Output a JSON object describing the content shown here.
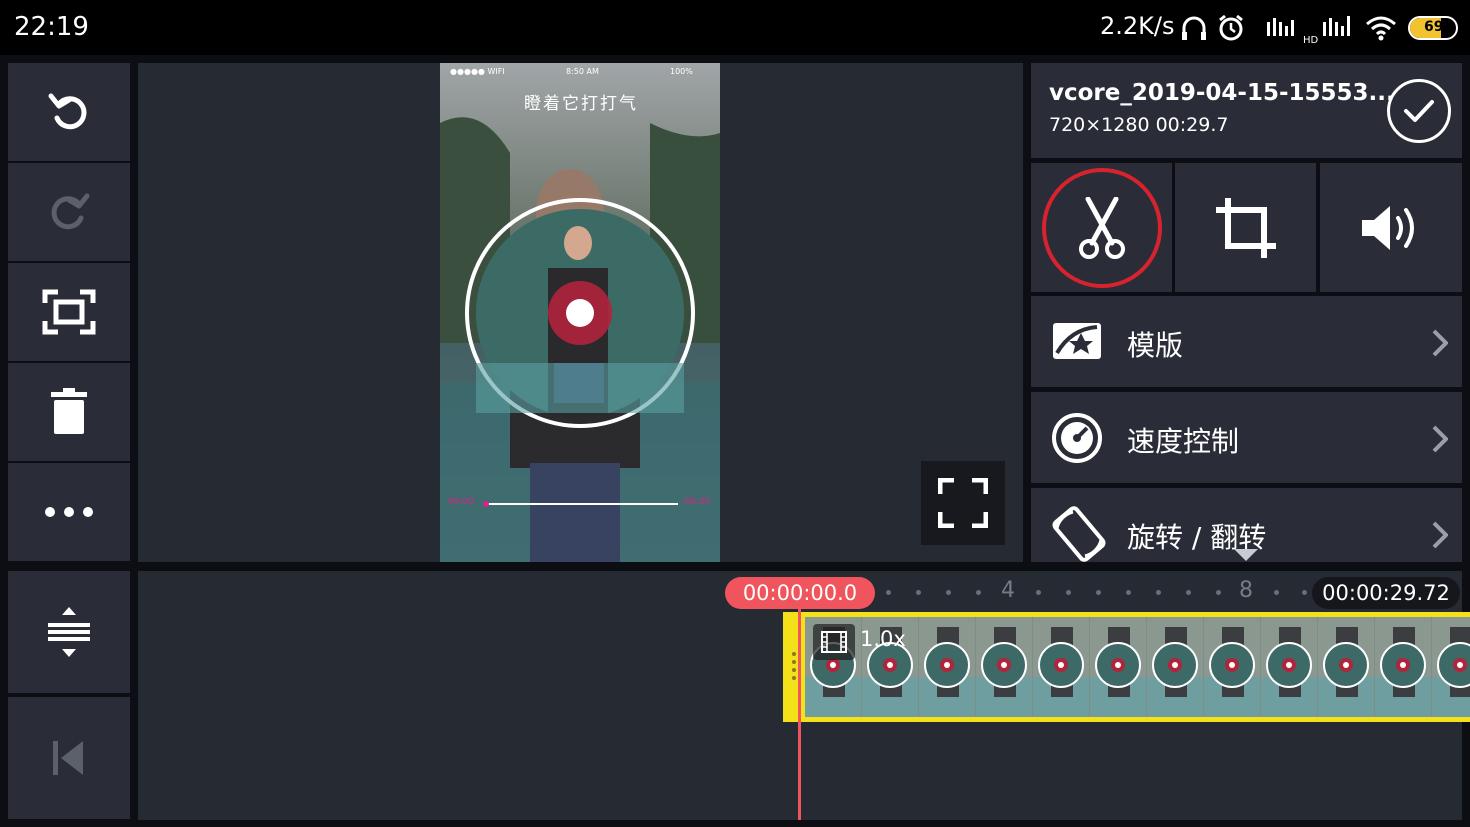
{
  "status_bar": {
    "time": "22:19",
    "net_speed": "2.2K/s",
    "battery": "69"
  },
  "left_toolbar": {
    "buttons": [
      "undo-icon",
      "redo-icon",
      "fit-screen-icon",
      "delete-icon",
      "more-icon"
    ],
    "timeline_buttons": [
      "expand-timeline-icon",
      "skip-to-start-icon"
    ]
  },
  "preview": {
    "phone_status_left": "●●●●● WIFI",
    "phone_time": "8:50 AM",
    "phone_battery": "100%",
    "video_caption": "瞪着它打打气",
    "time_left": "00:00",
    "time_right": "00:30"
  },
  "clip": {
    "name": "vcore_2019-04-15-15553...",
    "meta": "720×1280  00:29.7"
  },
  "tools": [
    "scissors-icon",
    "crop-icon",
    "volume-icon"
  ],
  "menu": [
    {
      "label": "模版",
      "icon": "template-icon"
    },
    {
      "label": "速度控制",
      "icon": "speedometer-icon"
    },
    {
      "label": "旋转 / 翻转",
      "icon": "rotate-icon"
    }
  ],
  "timeline": {
    "current_time": "00:00:00.0",
    "total_time": "00:00:29.72",
    "tick_labels": [
      "4",
      "8"
    ],
    "clip_speed": "1.0x"
  },
  "colors": {
    "accent_red": "#f0545c",
    "clip_border": "#f5e11a",
    "panel": "#2a2d37"
  }
}
